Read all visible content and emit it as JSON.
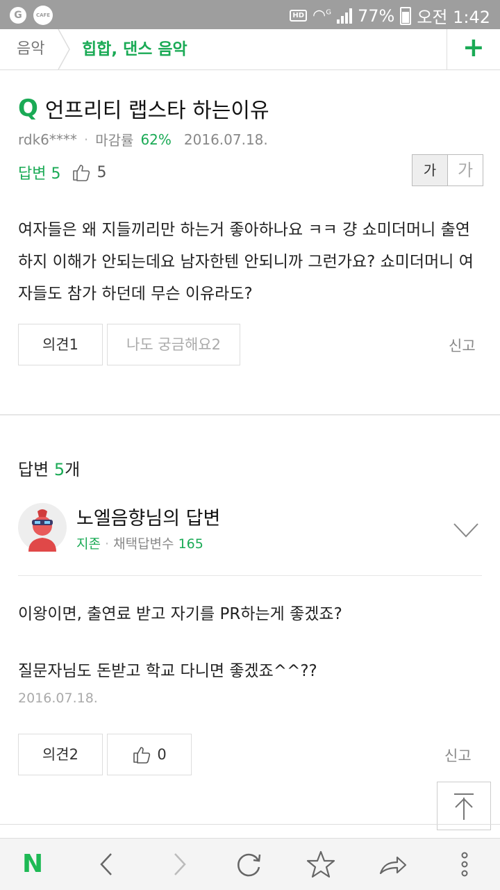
{
  "status_bar": {
    "battery": "77%",
    "time": "오전 1:42",
    "network": "G"
  },
  "breadcrumb": {
    "root": "음악",
    "current": "힙합, 댄스 음악"
  },
  "question": {
    "title": "언프리티 랩스타 하는이유",
    "user": "rdk6****",
    "close_rate_label": "마감률",
    "close_rate": "62%",
    "date": "2016.07.18.",
    "answers_label": "답변 5",
    "likes": "5",
    "font_small": "가",
    "font_large": "가",
    "body": "여자들은 왜 지들끼리만 하는거 좋아하나요 ㅋㅋ 걍 쇼미더머니 출연하지 이해가 안되는데요 남자한텐 안되니까 그런가요? 쇼미더머니 여자들도 참가 하던데 무슨 이유라도?",
    "opinion_button": "의견1",
    "curious_button": "나도 궁금해요2",
    "report": "신고"
  },
  "answers_section": {
    "label": "답변",
    "count": "5",
    "suffix": "개"
  },
  "answer": {
    "author": "노엘음향님의 답변",
    "rank": "지존",
    "adopted_label": "채택답변수",
    "adopted_count": "165",
    "line1": "이왕이면, 출연료 받고 자기를 PR하는게 좋겠죠?",
    "line2": "질문자님도 돈받고 학교 다니면 좋겠죠^^??",
    "date": "2016.07.18.",
    "opinion_button": "의견2",
    "likes": "0",
    "report": "신고"
  },
  "toolbar": {
    "logo": "N"
  },
  "colors": {
    "accent": "#1aaa55",
    "status_bar": "#9e9e9e"
  },
  "icons": [
    "search-q-icon",
    "thumbs-up-icon",
    "chevron-down-icon",
    "scroll-top-icon",
    "back-icon",
    "forward-icon",
    "reload-icon",
    "star-icon",
    "share-icon",
    "more-icon"
  ]
}
